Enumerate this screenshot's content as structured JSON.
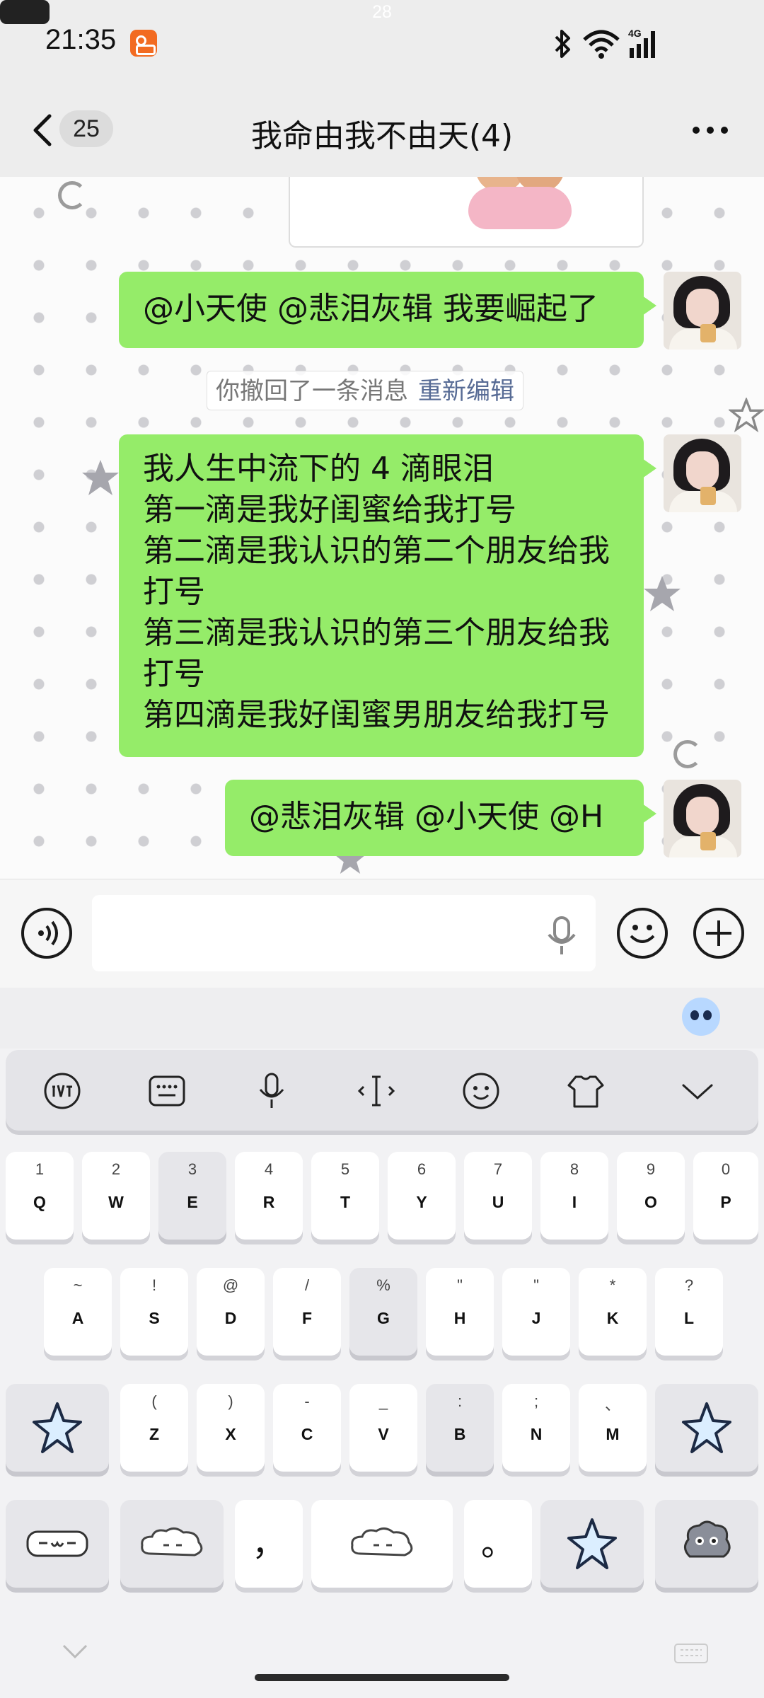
{
  "status_bar": {
    "time": "21:35",
    "network": "4G",
    "battery": "28"
  },
  "nav": {
    "unread_count": "25",
    "title": "我命由我不由天(4)"
  },
  "messages": [
    {
      "text": "@小天使 @悲泪灰辑  我要崛起了"
    },
    {
      "lines": [
        "我人生中流下的 4 滴眼泪",
        "第一滴是我好闺蜜给我打号",
        "第二滴是我认识的第二个朋友给我",
        "打号",
        "第三滴是我认识的第三个朋友给我",
        "打号",
        "第四滴是我好闺蜜男朋友给我打号"
      ]
    },
    {
      "text": "@悲泪灰辑 @小天使 @H"
    }
  ],
  "recall_notice": {
    "text": "你撤回了一条消息",
    "action": "重新编辑"
  },
  "input": {
    "value": ""
  },
  "keyboard": {
    "row1": [
      {
        "main": "Q",
        "sub": "1"
      },
      {
        "main": "W",
        "sub": "2"
      },
      {
        "main": "E",
        "sub": "3"
      },
      {
        "main": "R",
        "sub": "4"
      },
      {
        "main": "T",
        "sub": "5"
      },
      {
        "main": "Y",
        "sub": "6"
      },
      {
        "main": "U",
        "sub": "7"
      },
      {
        "main": "I",
        "sub": "8"
      },
      {
        "main": "O",
        "sub": "9"
      },
      {
        "main": "P",
        "sub": "0"
      }
    ],
    "row2": [
      {
        "main": "A",
        "sub": "~"
      },
      {
        "main": "S",
        "sub": "!"
      },
      {
        "main": "D",
        "sub": "@"
      },
      {
        "main": "F",
        "sub": "/"
      },
      {
        "main": "G",
        "sub": "%"
      },
      {
        "main": "H",
        "sub": "\""
      },
      {
        "main": "J",
        "sub": "\""
      },
      {
        "main": "K",
        "sub": "*"
      },
      {
        "main": "L",
        "sub": "?"
      }
    ],
    "row3": [
      {
        "main": "Z",
        "sub": "("
      },
      {
        "main": "X",
        "sub": ")"
      },
      {
        "main": "C",
        "sub": "-"
      },
      {
        "main": "V",
        "sub": "_"
      },
      {
        "main": "B",
        "sub": ":"
      },
      {
        "main": "N",
        "sub": ";"
      },
      {
        "main": "M",
        "sub": "、"
      }
    ],
    "comma": "，",
    "period": "。"
  },
  "colors": {
    "bubble": "#95ec69",
    "nav_bg": "#ededed",
    "link": "#576b95"
  }
}
